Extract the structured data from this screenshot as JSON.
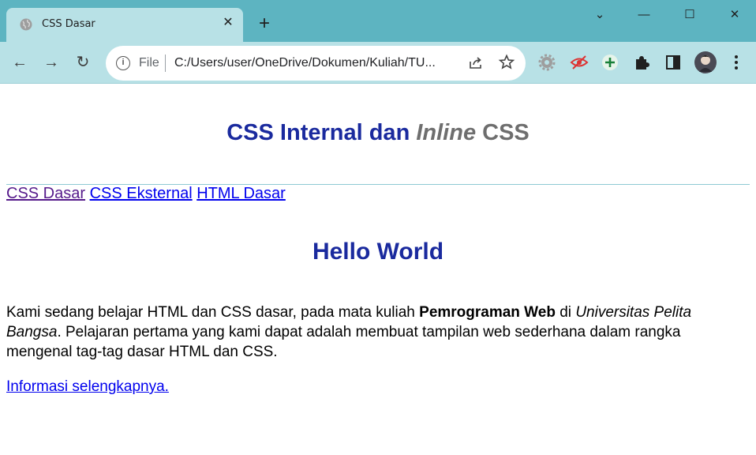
{
  "browser": {
    "tab_title": "CSS Dasar",
    "tab_close": "✕",
    "new_tab": "+",
    "window": {
      "dropdown": "⌄",
      "minimize": "—",
      "maximize": "☐",
      "close": "✕"
    },
    "nav": {
      "back": "←",
      "forward": "→",
      "reload": "↻"
    },
    "address": {
      "scheme": "File",
      "url": "C:/Users/user/OneDrive/Dokumen/Kuliah/TU..."
    },
    "icons": [
      "globe-icon",
      "info-icon",
      "share-icon",
      "star-icon",
      "settings-extension-icon",
      "hidden-eye-extension-icon",
      "plus-extension-icon",
      "puzzle-icon",
      "side-panel-icon",
      "profile-avatar",
      "kebab-menu-icon"
    ]
  },
  "page": {
    "title_part1": "CSS Internal dan ",
    "title_italic": "Inline",
    "title_part2": " CSS",
    "nav_links": [
      "CSS Dasar",
      "CSS Eksternal",
      "HTML Dasar"
    ],
    "heading": "Hello World",
    "paragraph": {
      "t1": "Kami sedang belajar HTML dan CSS dasar, pada mata kuliah ",
      "bold": "Pemrograman Web",
      "t2": " di ",
      "italic": "Universitas Pelita Bangsa",
      "t3": ". Pelajaran pertama yang kami dapat adalah membuat tampilan web sederhana dalam rangka mengenal tag-tag dasar HTML dan CSS."
    },
    "more_link": "Informasi selengkapnya."
  },
  "colors": {
    "heading": "#1a2a9e",
    "title_grey": "#6e6e6e",
    "link": "#0000ee",
    "visited_link": "#551a8b",
    "chrome_dark": "#5db4c1",
    "chrome_light": "#b8e1e6"
  }
}
